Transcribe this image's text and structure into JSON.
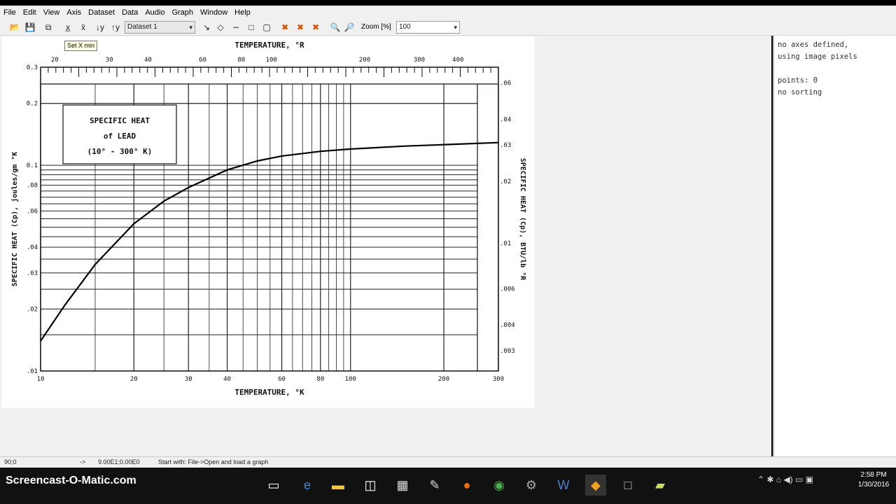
{
  "app": {
    "menus": [
      "File",
      "Edit",
      "View",
      "Axis",
      "Dataset",
      "Data",
      "Audio",
      "Graph",
      "Window",
      "Help"
    ]
  },
  "toolbar": {
    "dataset_select": "Dataset 1",
    "zoom_label": "Zoom [%]",
    "zoom_value": "100",
    "tooltip": "Set X min"
  },
  "chart": {
    "title_top": "TEMPERATURE, °R",
    "title_bottom": "TEMPERATURE, °K",
    "box_line1": "SPECIFIC  HEAT",
    "box_line2": "of  LEAD",
    "box_line3": "(10° - 300° K)",
    "ylabel_left": "SPECIFIC  HEAT  (Cp),  joules/gm °K",
    "ylabel_right": "SPECIFIC  HEAT (Cp),  BTU/lb °R"
  },
  "chart_data": {
    "type": "line",
    "title": "SPECIFIC HEAT of LEAD (10° - 300° K)",
    "xlabel": "TEMPERATURE, °K",
    "ylabel": "SPECIFIC HEAT (Cp), joules/gm °K",
    "xscale": "log",
    "yscale": "log",
    "xlim": [
      10,
      300
    ],
    "ylim": [
      0.01,
      0.3
    ],
    "x_ticks": [
      "10",
      "20",
      "30",
      "40",
      "60",
      "80",
      "100",
      "200",
      "300"
    ],
    "y_ticks": [
      ".01",
      ".02",
      ".03",
      ".04",
      ".06",
      ".08",
      "0.1",
      "0.2",
      "0.3"
    ],
    "top_axis": {
      "label": "TEMPERATURE, °R",
      "ticks": [
        "20",
        "30",
        "40",
        "60",
        "80",
        "100",
        "200",
        "300",
        "400"
      ]
    },
    "right_axis": {
      "label": "SPECIFIC HEAT (Cp), BTU/lb °R",
      "ticks": [
        ".003",
        ".004",
        ".006",
        ".01",
        ".02",
        ".03",
        ".04",
        ".06"
      ]
    },
    "series": [
      {
        "x": [
          10,
          12,
          15,
          18,
          20,
          25,
          30,
          40,
          50,
          60,
          80,
          100,
          150,
          200,
          300
        ],
        "y": [
          0.014,
          0.021,
          0.033,
          0.044,
          0.052,
          0.067,
          0.078,
          0.095,
          0.105,
          0.111,
          0.117,
          0.12,
          0.124,
          0.126,
          0.129
        ]
      }
    ]
  },
  "right_panel": {
    "line1": "no axes defined,",
    "line2": "using image pixels",
    "line3": "points: 0",
    "line4": "no sorting"
  },
  "status": {
    "coords": "90;0",
    "arrow": "->",
    "value": "9.00E1;0.00E0",
    "hint": "Start with: File->Open and load a graph"
  },
  "taskbar": {
    "brand": "Screencast-O-Matic.com",
    "time": "2:58 PM",
    "date": "1/30/2016"
  }
}
